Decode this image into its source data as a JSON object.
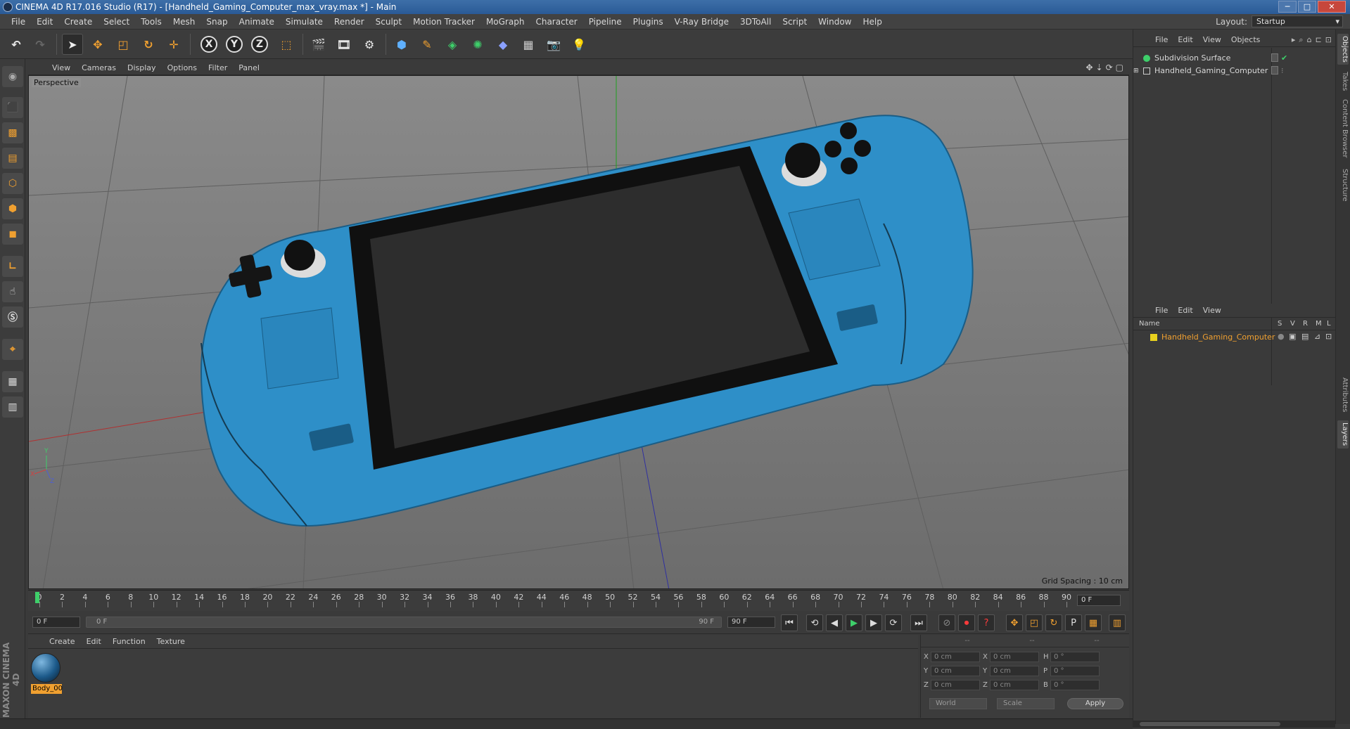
{
  "window": {
    "title": "CINEMA 4D R17.016 Studio (R17) - [Handheld_Gaming_Computer_max_vray.max *] - Main",
    "min": "─",
    "max": "□",
    "close": "✕"
  },
  "menu": [
    "File",
    "Edit",
    "Create",
    "Select",
    "Tools",
    "Mesh",
    "Snap",
    "Animate",
    "Simulate",
    "Render",
    "Sculpt",
    "Motion Tracker",
    "MoGraph",
    "Character",
    "Pipeline",
    "Plugins",
    "V-Ray Bridge",
    "3DToAll",
    "Script",
    "Window",
    "Help"
  ],
  "layout": {
    "label": "Layout:",
    "value": "Startup"
  },
  "toolbar": {
    "x_label": "X",
    "y_label": "Y",
    "z_label": "Z"
  },
  "viewport_menu": [
    "View",
    "Cameras",
    "Display",
    "Options",
    "Filter",
    "Panel"
  ],
  "viewport": {
    "label": "Perspective",
    "grid_spacing": "Grid Spacing : 10 cm",
    "axis_y": "Y",
    "axis_x": "X",
    "axis_z": "Z"
  },
  "timeline": {
    "ticks": [
      "0",
      "2",
      "4",
      "6",
      "8",
      "10",
      "12",
      "14",
      "16",
      "18",
      "20",
      "22",
      "24",
      "26",
      "28",
      "30",
      "32",
      "34",
      "36",
      "38",
      "40",
      "42",
      "44",
      "46",
      "48",
      "50",
      "52",
      "54",
      "56",
      "58",
      "60",
      "62",
      "64",
      "66",
      "68",
      "70",
      "72",
      "74",
      "76",
      "78",
      "80",
      "82",
      "84",
      "86",
      "88",
      "90"
    ],
    "current_frame": "0 F"
  },
  "transport": {
    "start": "0 F",
    "slider_start": "0 F",
    "slider_end": "90 F",
    "end": "90 F",
    "p_label": "P"
  },
  "material_menu": [
    "Create",
    "Edit",
    "Function",
    "Texture"
  ],
  "materials": [
    {
      "name": "Body_00"
    }
  ],
  "coords": {
    "headers": [
      "--",
      "--",
      "--"
    ],
    "rows": [
      {
        "a": "X",
        "av": "0 cm",
        "b": "X",
        "bv": "0 cm",
        "c": "H",
        "cv": "0 °"
      },
      {
        "a": "Y",
        "av": "0 cm",
        "b": "Y",
        "bv": "0 cm",
        "c": "P",
        "cv": "0 °"
      },
      {
        "a": "Z",
        "av": "0 cm",
        "b": "Z",
        "bv": "0 cm",
        "c": "B",
        "cv": "0 °"
      }
    ],
    "world": "World",
    "scale": "Scale",
    "apply": "Apply"
  },
  "objects_menu": [
    "File",
    "Edit",
    "View",
    "Objects"
  ],
  "objects": [
    {
      "name": "Subdivision Surface",
      "color": "#3ecf6a"
    },
    {
      "name": "Handheld_Gaming_Computer",
      "color": "#cccccc"
    }
  ],
  "layers_menu": [
    "File",
    "Edit",
    "View"
  ],
  "layers": {
    "headers": {
      "name": "Name",
      "s": "S",
      "v": "V",
      "r": "R",
      "m": "M",
      "l": "L"
    },
    "items": [
      {
        "name": "Handheld_Gaming_Computer",
        "color": "#e8d11e"
      }
    ]
  },
  "side_tabs": [
    "Objects",
    "Takes",
    "Content Browser",
    "Structure",
    "Attributes",
    "Layers"
  ],
  "brand": "MAXON CINEMA 4D",
  "colors": {
    "device_blue": "#2e8fc8",
    "accent_orange": "#f0a030",
    "playhead_green": "#3ecf6a"
  }
}
